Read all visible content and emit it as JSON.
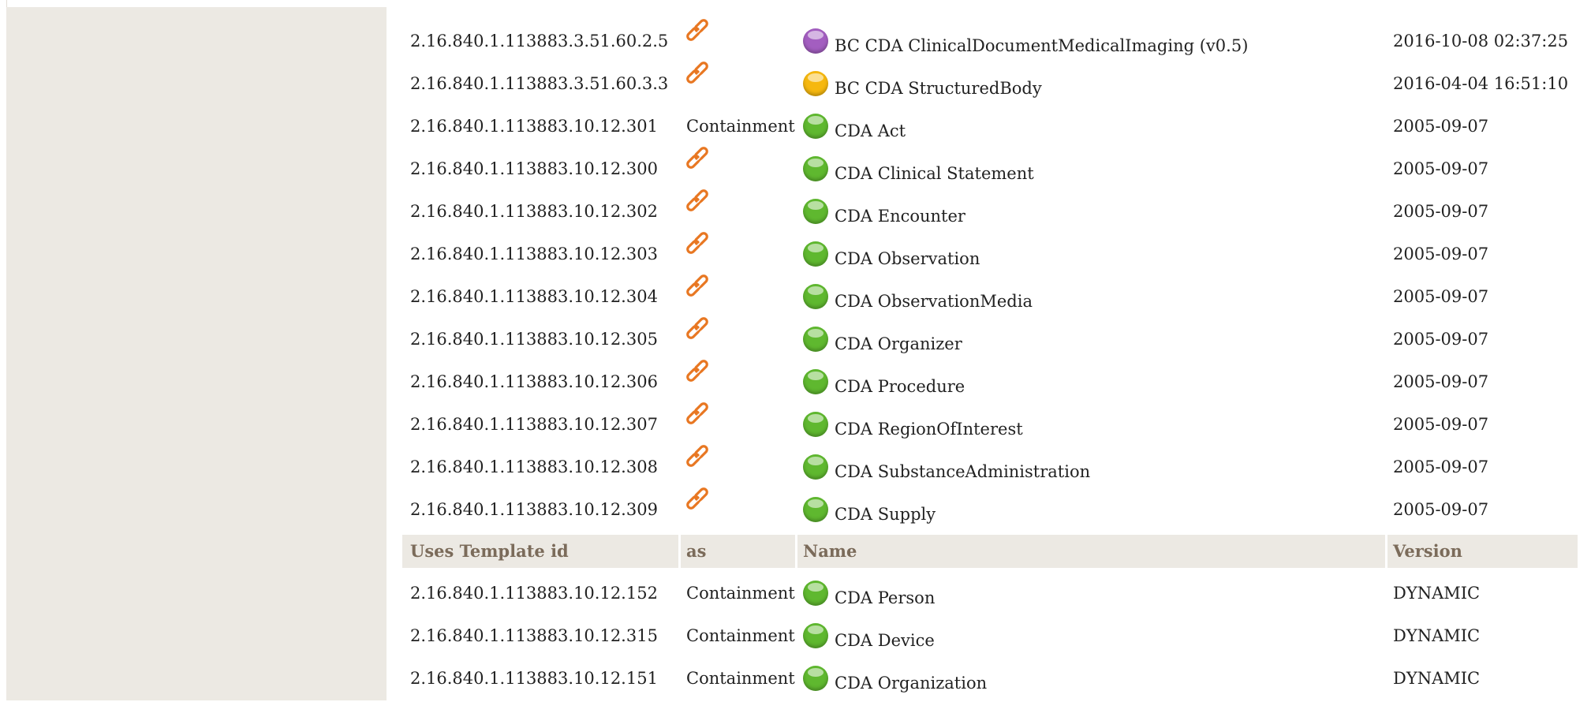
{
  "colors": {
    "sidebar": "#ece9e3",
    "header_bg": "#ece9e3",
    "header_text": "#7b6b5a",
    "link_icon": "#e87722",
    "status_green": "#5fb82f",
    "status_purple": "#a35ec0",
    "status_yellow": "#f6b80f"
  },
  "rows_top": [
    {
      "id": "2.16.840.1.113883.3.51.60.2.5",
      "as": "",
      "as_icon": "link-icon",
      "status": "purple",
      "name": "BC CDA ClinicalDocumentMedicalImaging (v0.5)",
      "version": "2016-10-08 02:37:25"
    },
    {
      "id": "2.16.840.1.113883.3.51.60.3.3",
      "as": "",
      "as_icon": "link-icon",
      "status": "yellow",
      "name": "BC CDA StructuredBody",
      "version": "2016-04-04 16:51:10"
    },
    {
      "id": "2.16.840.1.113883.10.12.301",
      "as": "Containment",
      "as_icon": "",
      "status": "green",
      "name": "CDA Act",
      "version": "2005-09-07"
    },
    {
      "id": "2.16.840.1.113883.10.12.300",
      "as": "",
      "as_icon": "link-icon",
      "status": "green",
      "name": "CDA Clinical Statement",
      "version": "2005-09-07"
    },
    {
      "id": "2.16.840.1.113883.10.12.302",
      "as": "",
      "as_icon": "link-icon",
      "status": "green",
      "name": "CDA Encounter",
      "version": "2005-09-07"
    },
    {
      "id": "2.16.840.1.113883.10.12.303",
      "as": "",
      "as_icon": "link-icon",
      "status": "green",
      "name": "CDA Observation",
      "version": "2005-09-07"
    },
    {
      "id": "2.16.840.1.113883.10.12.304",
      "as": "",
      "as_icon": "link-icon",
      "status": "green",
      "name": "CDA ObservationMedia",
      "version": "2005-09-07"
    },
    {
      "id": "2.16.840.1.113883.10.12.305",
      "as": "",
      "as_icon": "link-icon",
      "status": "green",
      "name": "CDA Organizer",
      "version": "2005-09-07"
    },
    {
      "id": "2.16.840.1.113883.10.12.306",
      "as": "",
      "as_icon": "link-icon",
      "status": "green",
      "name": "CDA Procedure",
      "version": "2005-09-07"
    },
    {
      "id": "2.16.840.1.113883.10.12.307",
      "as": "",
      "as_icon": "link-icon",
      "status": "green",
      "name": "CDA RegionOfInterest",
      "version": "2005-09-07"
    },
    {
      "id": "2.16.840.1.113883.10.12.308",
      "as": "",
      "as_icon": "link-icon",
      "status": "green",
      "name": "CDA SubstanceAdministration",
      "version": "2005-09-07"
    },
    {
      "id": "2.16.840.1.113883.10.12.309",
      "as": "",
      "as_icon": "link-icon",
      "status": "green",
      "name": "CDA Supply",
      "version": "2005-09-07"
    }
  ],
  "uses_header": {
    "id": "Uses Template id",
    "as": "as",
    "name": "Name",
    "version": "Version"
  },
  "rows_uses": [
    {
      "id": "2.16.840.1.113883.10.12.152",
      "as": "Containment",
      "as_icon": "",
      "status": "green",
      "name": "CDA Person",
      "version": "DYNAMIC"
    },
    {
      "id": "2.16.840.1.113883.10.12.315",
      "as": "Containment",
      "as_icon": "",
      "status": "green",
      "name": "CDA Device",
      "version": "DYNAMIC"
    },
    {
      "id": "2.16.840.1.113883.10.12.151",
      "as": "Containment",
      "as_icon": "",
      "status": "green",
      "name": "CDA Organization",
      "version": "DYNAMIC"
    }
  ]
}
